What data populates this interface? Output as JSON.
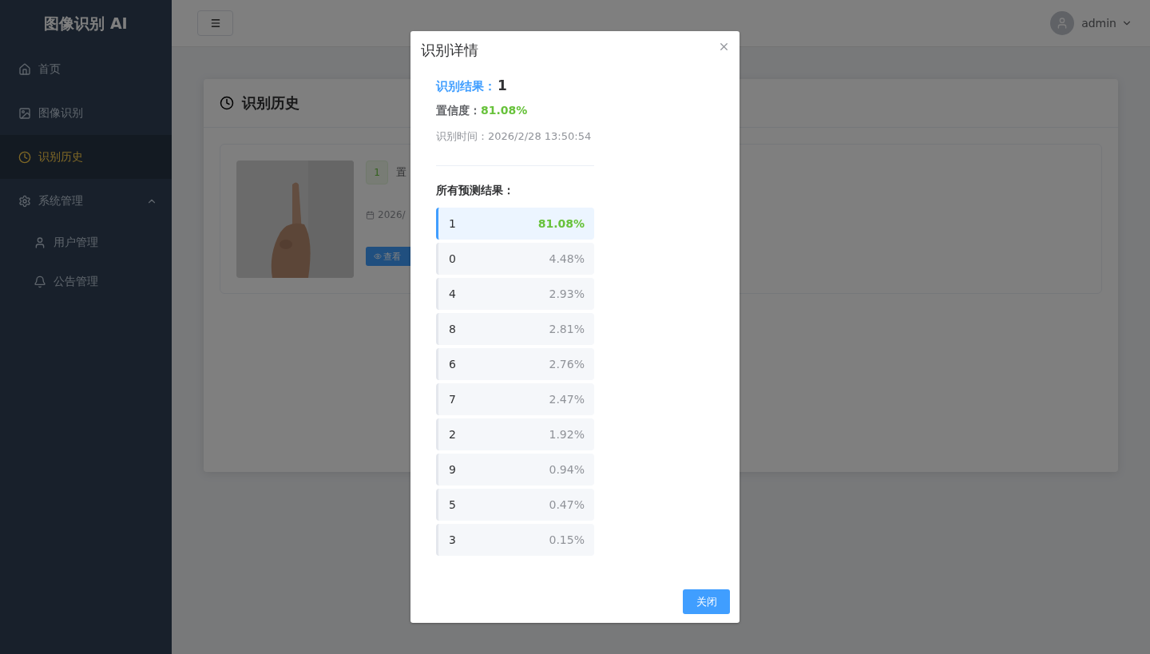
{
  "sidebar": {
    "title": "图像识别 AI",
    "items": [
      {
        "label": "首页",
        "selected": false
      },
      {
        "label": "图像识别",
        "selected": false
      },
      {
        "label": "识别历史",
        "selected": true
      },
      {
        "label": "系统管理",
        "selected": false,
        "expanded": true,
        "children": [
          {
            "label": "用户管理",
            "selected": false
          },
          {
            "label": "公告管理",
            "selected": false
          }
        ]
      }
    ]
  },
  "header": {
    "user": "admin"
  },
  "panel": {
    "title": "识别历史",
    "records": [
      {
        "tag": "1",
        "confidence": "置",
        "date": "2026/",
        "button": "查看"
      }
    ]
  },
  "dialog": {
    "title": "识别详情",
    "result_label": "识别结果：",
    "result_value": "1",
    "confidence_label": "置信度：",
    "confidence_value": "81.08%",
    "time": "识别时间：2026/2/28 13:50:54",
    "predictions_title": "所有预测结果：",
    "predictions": [
      {
        "label": "1",
        "value": "81.08%",
        "selected": true
      },
      {
        "label": "0",
        "value": "4.48%",
        "selected": false
      },
      {
        "label": "4",
        "value": "2.93%",
        "selected": false
      },
      {
        "label": "8",
        "value": "2.81%",
        "selected": false
      },
      {
        "label": "6",
        "value": "2.76%",
        "selected": false
      },
      {
        "label": "7",
        "value": "2.47%",
        "selected": false
      },
      {
        "label": "2",
        "value": "1.92%",
        "selected": false
      },
      {
        "label": "9",
        "value": "0.94%",
        "selected": false
      },
      {
        "label": "5",
        "value": "0.47%",
        "selected": false
      },
      {
        "label": "3",
        "value": "0.15%",
        "selected": false
      }
    ],
    "close_button": "关闭"
  }
}
